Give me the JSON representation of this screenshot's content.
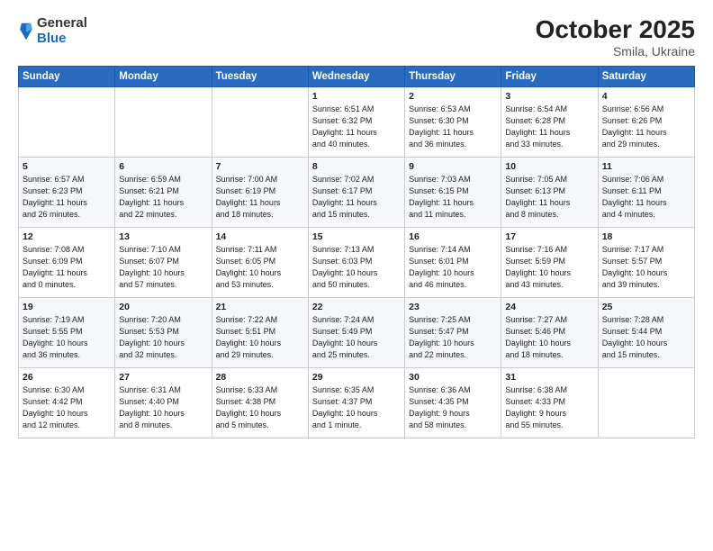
{
  "logo": {
    "general": "General",
    "blue": "Blue"
  },
  "header": {
    "month": "October 2025",
    "location": "Smila, Ukraine"
  },
  "weekdays": [
    "Sunday",
    "Monday",
    "Tuesday",
    "Wednesday",
    "Thursday",
    "Friday",
    "Saturday"
  ],
  "weeks": [
    [
      {
        "day": "",
        "info": ""
      },
      {
        "day": "",
        "info": ""
      },
      {
        "day": "",
        "info": ""
      },
      {
        "day": "1",
        "info": "Sunrise: 6:51 AM\nSunset: 6:32 PM\nDaylight: 11 hours\nand 40 minutes."
      },
      {
        "day": "2",
        "info": "Sunrise: 6:53 AM\nSunset: 6:30 PM\nDaylight: 11 hours\nand 36 minutes."
      },
      {
        "day": "3",
        "info": "Sunrise: 6:54 AM\nSunset: 6:28 PM\nDaylight: 11 hours\nand 33 minutes."
      },
      {
        "day": "4",
        "info": "Sunrise: 6:56 AM\nSunset: 6:26 PM\nDaylight: 11 hours\nand 29 minutes."
      }
    ],
    [
      {
        "day": "5",
        "info": "Sunrise: 6:57 AM\nSunset: 6:23 PM\nDaylight: 11 hours\nand 26 minutes."
      },
      {
        "day": "6",
        "info": "Sunrise: 6:59 AM\nSunset: 6:21 PM\nDaylight: 11 hours\nand 22 minutes."
      },
      {
        "day": "7",
        "info": "Sunrise: 7:00 AM\nSunset: 6:19 PM\nDaylight: 11 hours\nand 18 minutes."
      },
      {
        "day": "8",
        "info": "Sunrise: 7:02 AM\nSunset: 6:17 PM\nDaylight: 11 hours\nand 15 minutes."
      },
      {
        "day": "9",
        "info": "Sunrise: 7:03 AM\nSunset: 6:15 PM\nDaylight: 11 hours\nand 11 minutes."
      },
      {
        "day": "10",
        "info": "Sunrise: 7:05 AM\nSunset: 6:13 PM\nDaylight: 11 hours\nand 8 minutes."
      },
      {
        "day": "11",
        "info": "Sunrise: 7:06 AM\nSunset: 6:11 PM\nDaylight: 11 hours\nand 4 minutes."
      }
    ],
    [
      {
        "day": "12",
        "info": "Sunrise: 7:08 AM\nSunset: 6:09 PM\nDaylight: 11 hours\nand 0 minutes."
      },
      {
        "day": "13",
        "info": "Sunrise: 7:10 AM\nSunset: 6:07 PM\nDaylight: 10 hours\nand 57 minutes."
      },
      {
        "day": "14",
        "info": "Sunrise: 7:11 AM\nSunset: 6:05 PM\nDaylight: 10 hours\nand 53 minutes."
      },
      {
        "day": "15",
        "info": "Sunrise: 7:13 AM\nSunset: 6:03 PM\nDaylight: 10 hours\nand 50 minutes."
      },
      {
        "day": "16",
        "info": "Sunrise: 7:14 AM\nSunset: 6:01 PM\nDaylight: 10 hours\nand 46 minutes."
      },
      {
        "day": "17",
        "info": "Sunrise: 7:16 AM\nSunset: 5:59 PM\nDaylight: 10 hours\nand 43 minutes."
      },
      {
        "day": "18",
        "info": "Sunrise: 7:17 AM\nSunset: 5:57 PM\nDaylight: 10 hours\nand 39 minutes."
      }
    ],
    [
      {
        "day": "19",
        "info": "Sunrise: 7:19 AM\nSunset: 5:55 PM\nDaylight: 10 hours\nand 36 minutes."
      },
      {
        "day": "20",
        "info": "Sunrise: 7:20 AM\nSunset: 5:53 PM\nDaylight: 10 hours\nand 32 minutes."
      },
      {
        "day": "21",
        "info": "Sunrise: 7:22 AM\nSunset: 5:51 PM\nDaylight: 10 hours\nand 29 minutes."
      },
      {
        "day": "22",
        "info": "Sunrise: 7:24 AM\nSunset: 5:49 PM\nDaylight: 10 hours\nand 25 minutes."
      },
      {
        "day": "23",
        "info": "Sunrise: 7:25 AM\nSunset: 5:47 PM\nDaylight: 10 hours\nand 22 minutes."
      },
      {
        "day": "24",
        "info": "Sunrise: 7:27 AM\nSunset: 5:46 PM\nDaylight: 10 hours\nand 18 minutes."
      },
      {
        "day": "25",
        "info": "Sunrise: 7:28 AM\nSunset: 5:44 PM\nDaylight: 10 hours\nand 15 minutes."
      }
    ],
    [
      {
        "day": "26",
        "info": "Sunrise: 6:30 AM\nSunset: 4:42 PM\nDaylight: 10 hours\nand 12 minutes."
      },
      {
        "day": "27",
        "info": "Sunrise: 6:31 AM\nSunset: 4:40 PM\nDaylight: 10 hours\nand 8 minutes."
      },
      {
        "day": "28",
        "info": "Sunrise: 6:33 AM\nSunset: 4:38 PM\nDaylight: 10 hours\nand 5 minutes."
      },
      {
        "day": "29",
        "info": "Sunrise: 6:35 AM\nSunset: 4:37 PM\nDaylight: 10 hours\nand 1 minute."
      },
      {
        "day": "30",
        "info": "Sunrise: 6:36 AM\nSunset: 4:35 PM\nDaylight: 9 hours\nand 58 minutes."
      },
      {
        "day": "31",
        "info": "Sunrise: 6:38 AM\nSunset: 4:33 PM\nDaylight: 9 hours\nand 55 minutes."
      },
      {
        "day": "",
        "info": ""
      }
    ]
  ]
}
